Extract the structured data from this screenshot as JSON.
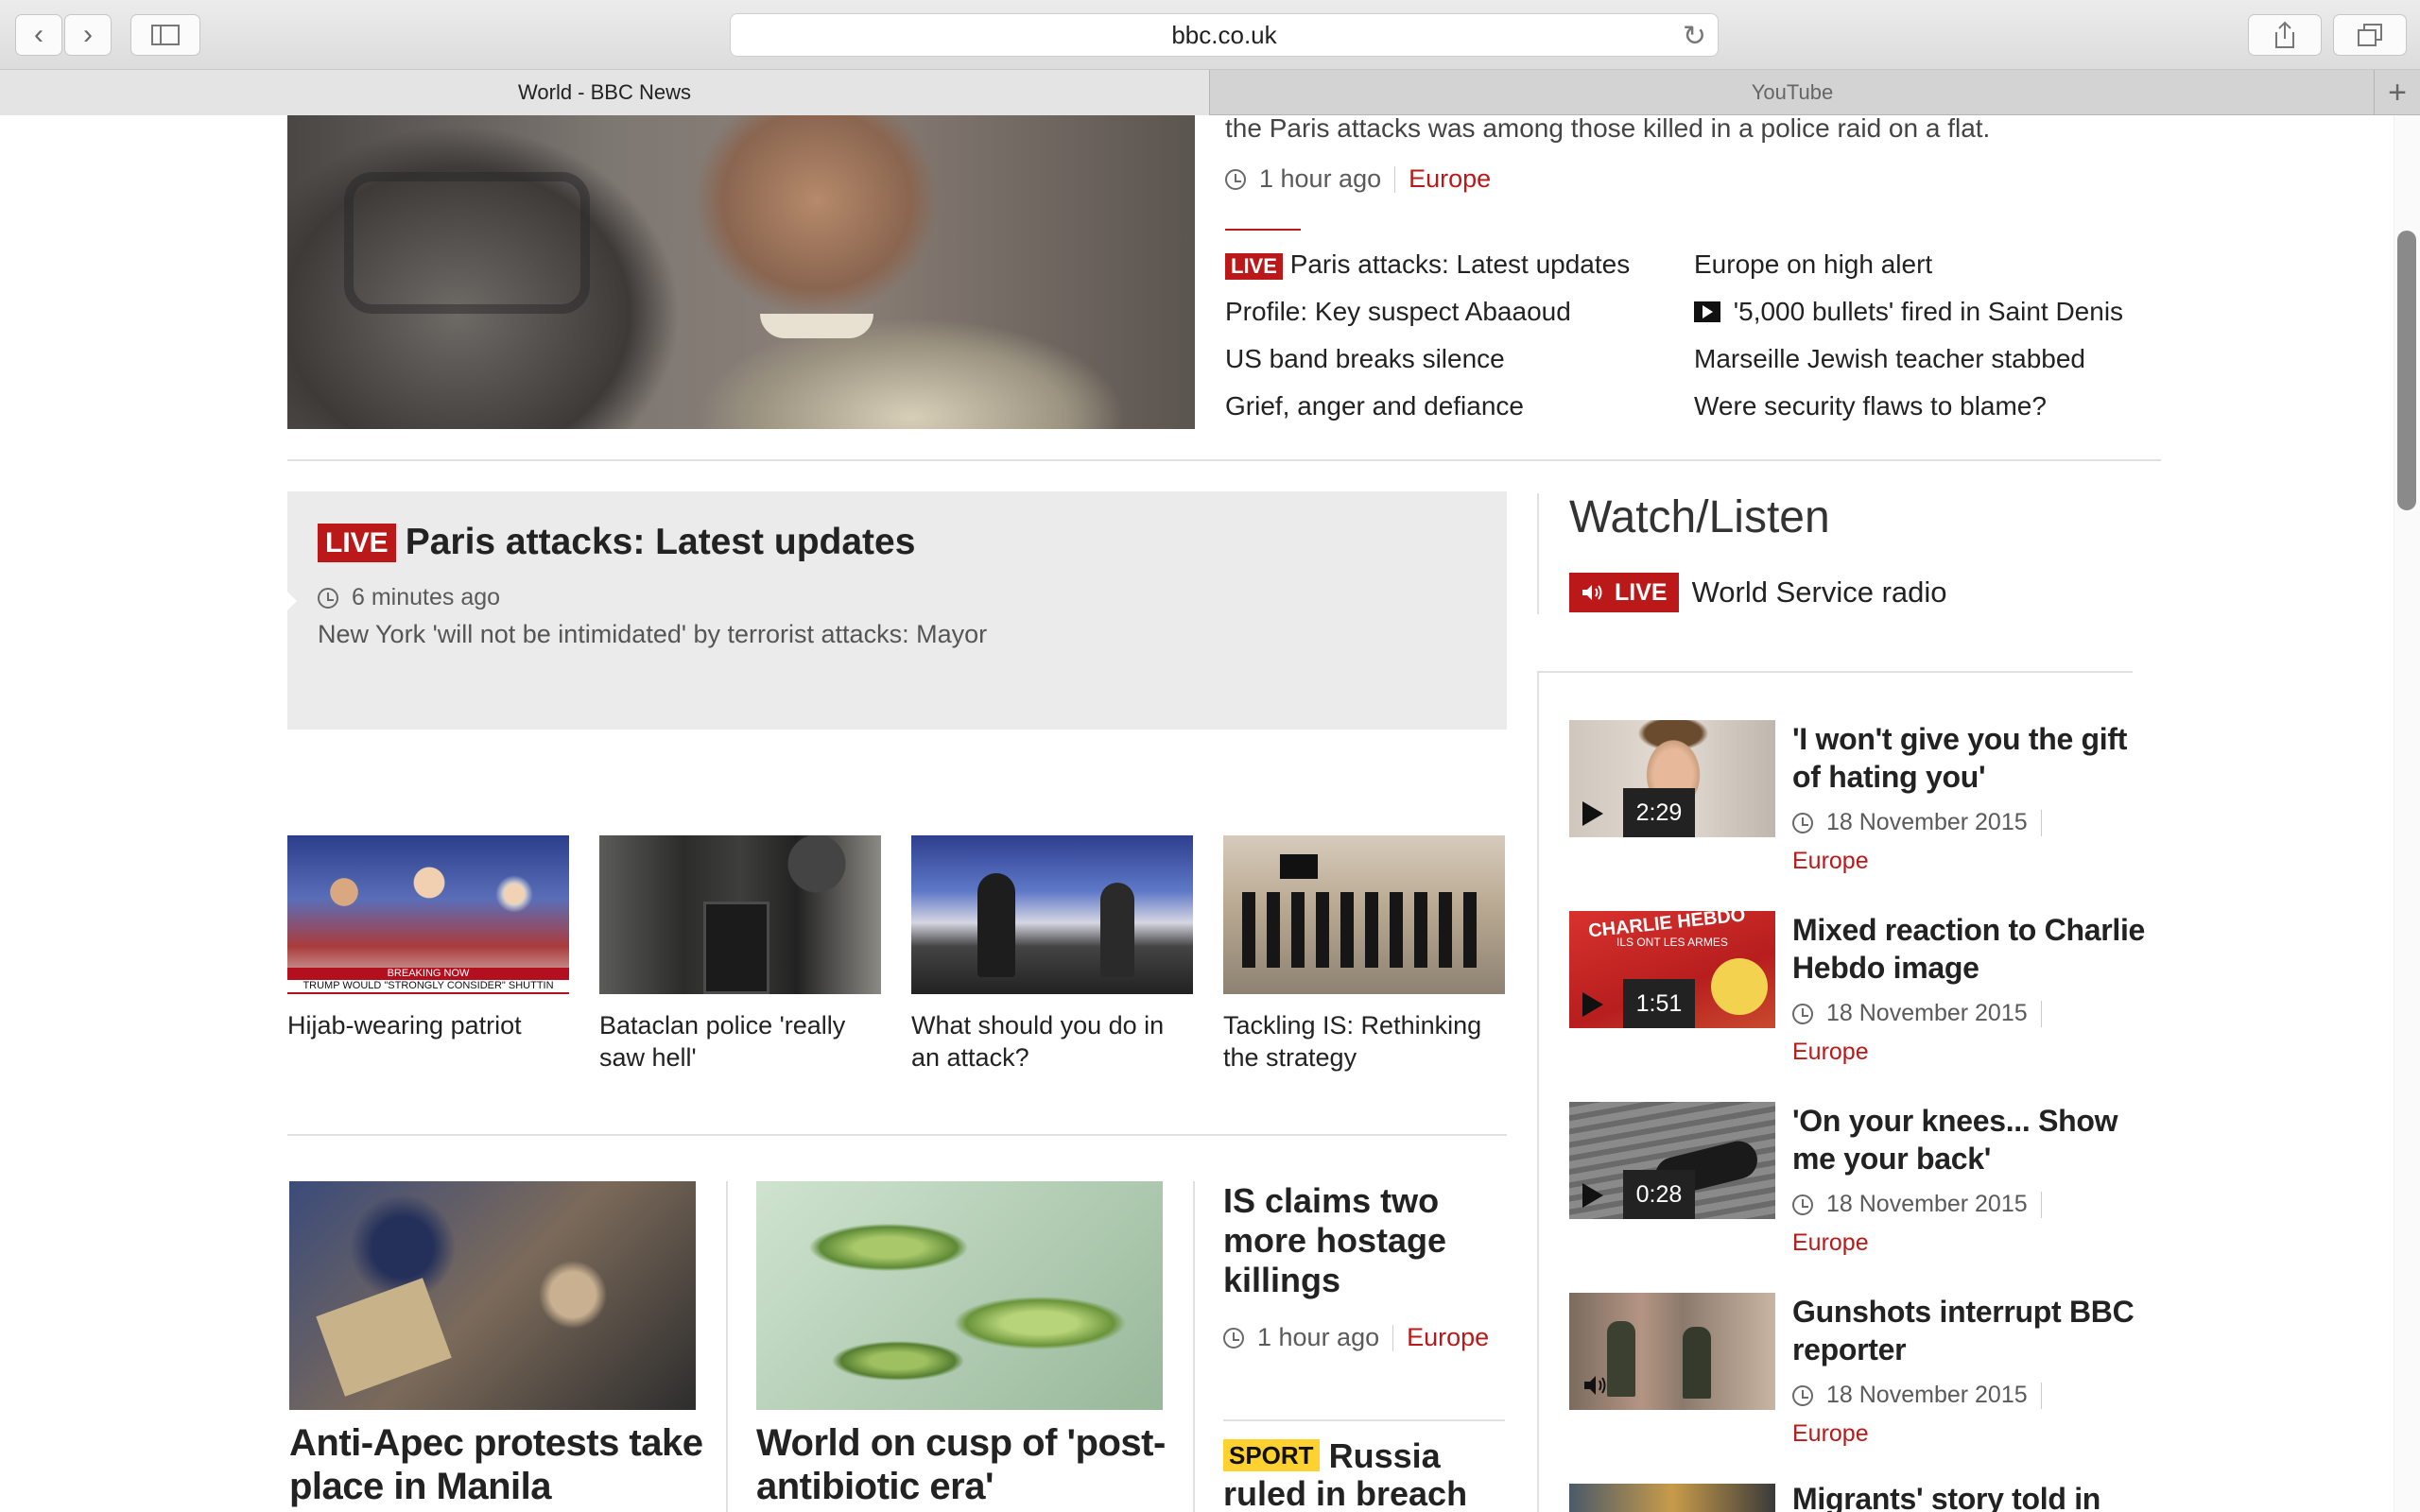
{
  "browser": {
    "url": "bbc.co.uk",
    "tabs": [
      {
        "label": "World - BBC News",
        "active": true
      },
      {
        "label": "YouTube",
        "active": false
      }
    ],
    "new_tab_label": "+"
  },
  "lead": {
    "summary_tail": "the Paris attacks was among those killed in a police raid on a flat.",
    "time": "1 hour ago",
    "category": "Europe",
    "related": [
      {
        "label": "Paris attacks: Latest updates",
        "live": true,
        "live_label": "LIVE"
      },
      {
        "label": "Europe on high alert"
      },
      {
        "label": "Profile: Key suspect Abaaoud"
      },
      {
        "label": "'5,000 bullets' fired in Saint Denis",
        "video": true
      },
      {
        "label": "US band breaks silence"
      },
      {
        "label": "Marseille Jewish teacher stabbed"
      },
      {
        "label": "Grief, anger and defiance"
      },
      {
        "label": "Were security flaws to blame?"
      }
    ]
  },
  "live_box": {
    "live_label": "LIVE",
    "title": "Paris attacks: Latest updates",
    "time": "6 minutes ago",
    "summary": "New York 'will not be intimidated' by terrorist attacks: Mayor"
  },
  "thumbs": [
    {
      "caption": "Hijab-wearing patriot",
      "overlay_text": "BREAKING NOW",
      "overlay_sub": "TRUMP WOULD \"STRONGLY CONSIDER\" SHUTTIN"
    },
    {
      "caption": "Bataclan police 'really saw hell'"
    },
    {
      "caption": "What should you do in an attack?"
    },
    {
      "caption": "Tackling IS: Rethinking the strategy"
    }
  ],
  "stories": [
    {
      "headline": "Anti-Apec protests take place in Manila"
    },
    {
      "headline": "World on cusp of 'post-antibiotic era'"
    }
  ],
  "side_story": {
    "headline": "IS claims two more hostage killings",
    "time": "1 hour ago",
    "category": "Europe"
  },
  "sport_story": {
    "badge": "SPORT",
    "headline": "Russia ruled in breach of"
  },
  "watch": {
    "title": "Watch/Listen",
    "live_label": "LIVE",
    "radio_label": "World Service radio",
    "items": [
      {
        "headline": "'I won't give you the gift of hating you'",
        "duration": "2:29",
        "date": "18 November 2015",
        "category": "Europe"
      },
      {
        "headline": "Mixed reaction to Charlie Hebdo image",
        "duration": "1:51",
        "date": "18 November 2015",
        "category": "Europe",
        "thumb_text": "CHARLIE HEBDO",
        "thumb_sub": "ILS ONT LES ARMES"
      },
      {
        "headline": "'On your knees... Show me your back'",
        "duration": "0:28",
        "date": "18 November 2015",
        "category": "Europe"
      },
      {
        "headline": "Gunshots interrupt BBC reporter",
        "date": "18 November 2015",
        "category": "Europe"
      },
      {
        "headline": "Migrants' story told in"
      }
    ]
  },
  "colors": {
    "bbc_red": "#bb1919",
    "sport_yellow": "#ffd230"
  }
}
